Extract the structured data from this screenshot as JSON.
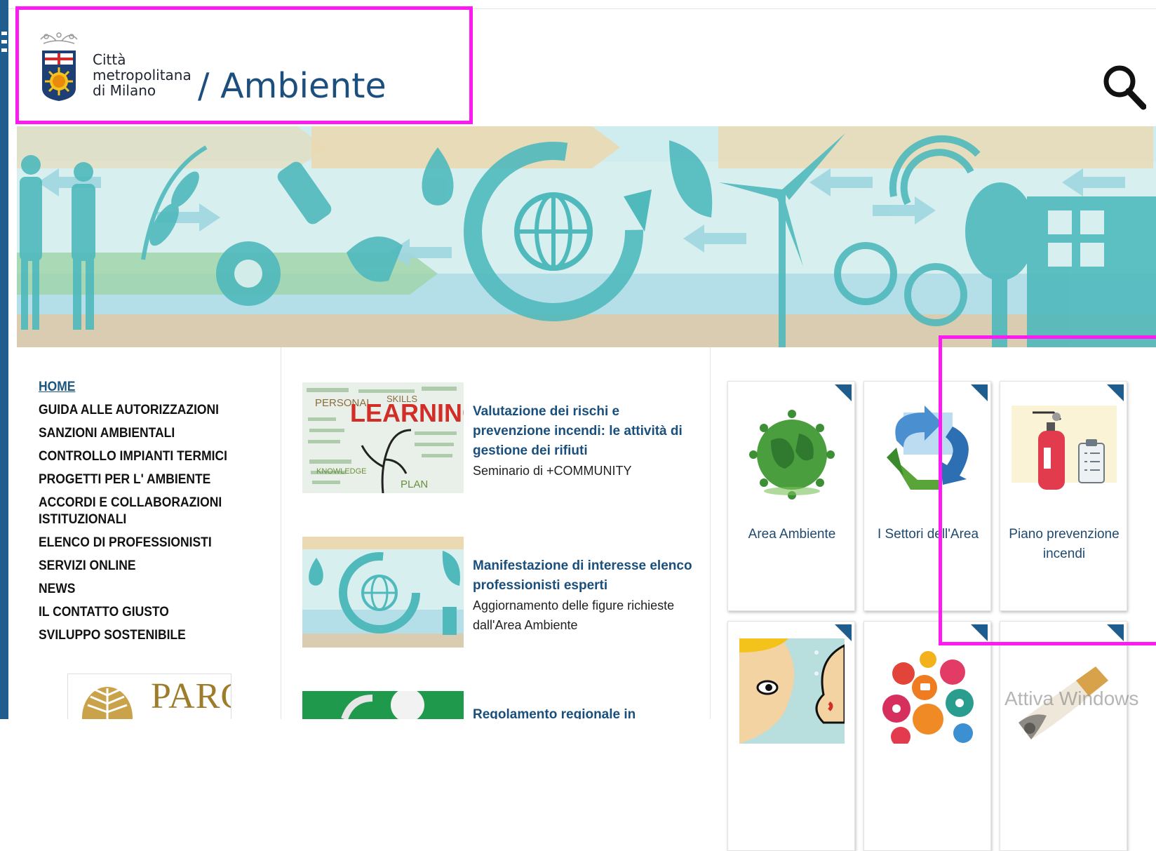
{
  "header": {
    "logo_lines": [
      "Città",
      "metropolitana",
      "di Milano"
    ],
    "section_title": "/ Ambiente"
  },
  "nav": {
    "items": [
      {
        "label": "HOME",
        "active": true
      },
      {
        "label": "GUIDA ALLE AUTORIZZAZIONI"
      },
      {
        "label": "SANZIONI AMBIENTALI"
      },
      {
        "label": "CONTROLLO IMPIANTI TERMICI"
      },
      {
        "label": "PROGETTI PER L' AMBIENTE"
      },
      {
        "label": "ACCORDI E COLLABORAZIONI ISTITUZIONALI"
      },
      {
        "label": "ELENCO DI PROFESSIONISTI"
      },
      {
        "label": "SERVIZI ONLINE"
      },
      {
        "label": "NEWS"
      },
      {
        "label": "IL CONTATTO GIUSTO"
      },
      {
        "label": "SVILUPPO SOSTENIBILE"
      }
    ],
    "parco_text": "PARCO"
  },
  "news": [
    {
      "title": "Valutazione dei rischi e prevenzione incendi: le attività di gestione dei rifiuti",
      "subtitle": "Seminario di +COMMUNITY",
      "thumb_word": "LEARNING"
    },
    {
      "title": "Manifestazione di interesse elenco professionisti esperti",
      "subtitle": "Aggiornamento delle figure richieste dall'Area Ambiente"
    },
    {
      "title": "Regolamento regionale in"
    }
  ],
  "cards": [
    {
      "label": "Area Ambiente",
      "icon": "globe-icon"
    },
    {
      "label": "I Settori dell'Area",
      "icon": "recycle-icon"
    },
    {
      "label": "Piano prevenzione incendi",
      "icon": "fire-extinguisher-icon"
    },
    {
      "label": "",
      "icon": "comic-face-icon"
    },
    {
      "label": "",
      "icon": "social-bubbles-icon"
    },
    {
      "label": "",
      "icon": "cigarette-icon"
    }
  ],
  "watermark": "Attiva Windows",
  "colors": {
    "accent": "#1c4f7d",
    "highlight": "#ff19f2",
    "banner_teal": "#5fbfc4"
  }
}
